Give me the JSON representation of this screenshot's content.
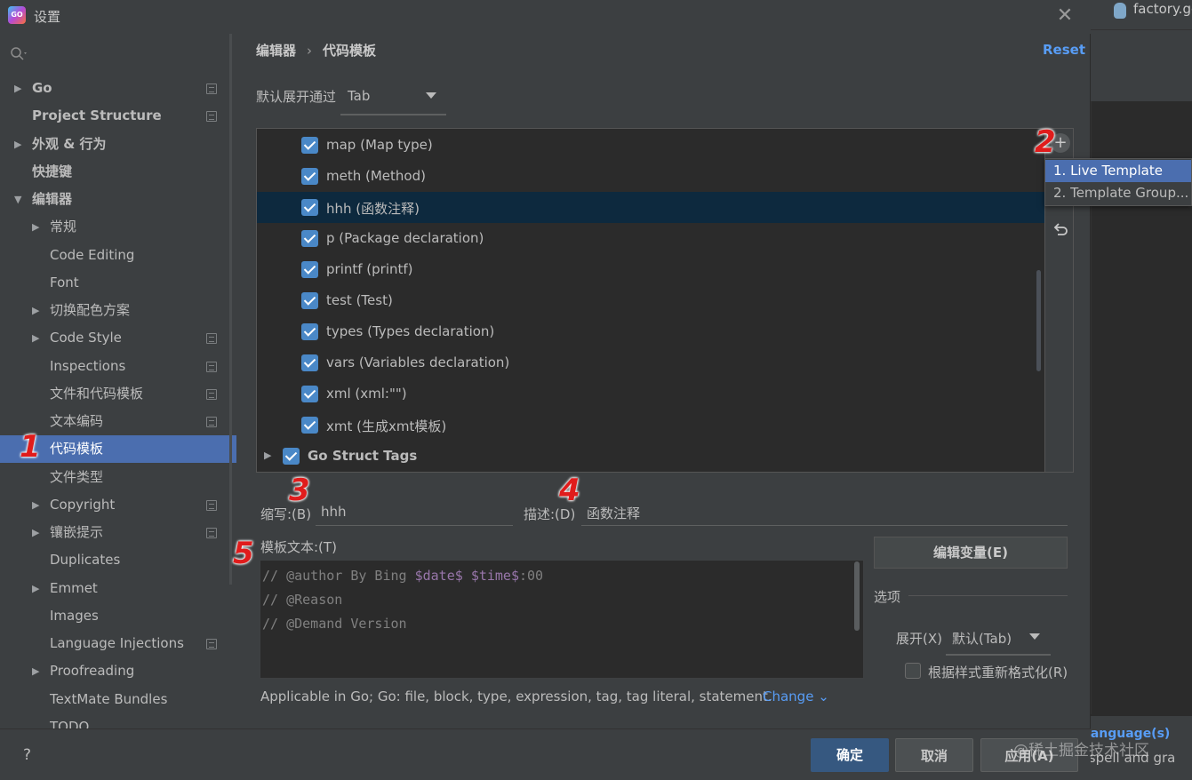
{
  "window": {
    "title": "设置",
    "app_icon": "GO"
  },
  "background_ide": {
    "tab_name": "factory.go",
    "bottom_line1": "g Language(s)",
    "bottom_line2": "se spell and gra"
  },
  "sidebar": {
    "items": [
      {
        "label": "Go",
        "arrow": "▶",
        "bold": true,
        "proj": true
      },
      {
        "label": "Project Structure",
        "arrow": "",
        "bold": true,
        "proj": true
      },
      {
        "label": "外观 & 行为",
        "arrow": "▶",
        "bold": true,
        "proj": false
      },
      {
        "label": "快捷键",
        "arrow": "",
        "bold": true,
        "proj": false
      },
      {
        "label": "编辑器",
        "arrow": "▼",
        "bold": true,
        "proj": false
      },
      {
        "label": "常规",
        "arrow": "▶",
        "bold": false,
        "proj": false
      },
      {
        "label": "Code Editing",
        "arrow": "",
        "bold": false,
        "proj": false
      },
      {
        "label": "Font",
        "arrow": "",
        "bold": false,
        "proj": false
      },
      {
        "label": "切换配色方案",
        "arrow": "▶",
        "bold": false,
        "proj": false
      },
      {
        "label": "Code Style",
        "arrow": "▶",
        "bold": false,
        "proj": true
      },
      {
        "label": "Inspections",
        "arrow": "",
        "bold": false,
        "proj": true
      },
      {
        "label": "文件和代码模板",
        "arrow": "",
        "bold": false,
        "proj": true
      },
      {
        "label": "文本编码",
        "arrow": "",
        "bold": false,
        "proj": true
      },
      {
        "label": "代码模板",
        "arrow": "",
        "bold": false,
        "proj": false,
        "selected": true
      },
      {
        "label": "文件类型",
        "arrow": "",
        "bold": false,
        "proj": false
      },
      {
        "label": "Copyright",
        "arrow": "▶",
        "bold": false,
        "proj": true
      },
      {
        "label": "镶嵌提示",
        "arrow": "▶",
        "bold": false,
        "proj": true
      },
      {
        "label": "Duplicates",
        "arrow": "",
        "bold": false,
        "proj": false
      },
      {
        "label": "Emmet",
        "arrow": "▶",
        "bold": false,
        "proj": false
      },
      {
        "label": "Images",
        "arrow": "",
        "bold": false,
        "proj": false
      },
      {
        "label": "Language Injections",
        "arrow": "",
        "bold": false,
        "proj": true
      },
      {
        "label": "Proofreading",
        "arrow": "▶",
        "bold": false,
        "proj": false
      },
      {
        "label": "TextMate Bundles",
        "arrow": "",
        "bold": false,
        "proj": false
      },
      {
        "label": "TODO",
        "arrow": "",
        "bold": false,
        "proj": false
      }
    ]
  },
  "breadcrumb": {
    "parent": "编辑器",
    "separator": "›",
    "current": "代码模板"
  },
  "reset_label": "Reset",
  "expand_with": {
    "label": "默认展开通过",
    "value": "Tab"
  },
  "templates": [
    {
      "text": "map (Map type)",
      "checked": true
    },
    {
      "text": "meth (Method)",
      "checked": true
    },
    {
      "text": "hhh (函数注释)",
      "checked": true,
      "selected": true
    },
    {
      "text": "p (Package declaration)",
      "checked": true
    },
    {
      "text": "printf (printf)",
      "checked": true
    },
    {
      "text": "test (Test)",
      "checked": true
    },
    {
      "text": "types (Types declaration)",
      "checked": true
    },
    {
      "text": "vars (Variables declaration)",
      "checked": true
    },
    {
      "text": "xml (xml:\"\")",
      "checked": true
    },
    {
      "text": "xmt (生成xmt模板)",
      "checked": true
    },
    {
      "text": "Go Struct Tags",
      "checked": true,
      "group": true
    }
  ],
  "toolbar_icons": {
    "add": "plus-icon",
    "remove": "minus-icon",
    "restore": "undo-icon"
  },
  "add_popup": {
    "items": [
      "1. Live Template",
      "2. Template Group..."
    ],
    "active_index": 0
  },
  "callouts": [
    "1",
    "2",
    "3",
    "4",
    "5"
  ],
  "detail": {
    "abbreviation_label": "缩写:(B)",
    "abbreviation_value": "hhh",
    "description_label": "描述:(D)",
    "description_value": "函数注释",
    "template_text_label": "模板文本:(T)",
    "code_lines": [
      {
        "before": "// @author By Bing ",
        "var1": "$date$",
        "mid": " ",
        "var2": "$time$",
        "after": ":00"
      },
      {
        "before": "// @Reason",
        "var1": "",
        "mid": "",
        "var2": "",
        "after": ""
      },
      {
        "before": "// @Demand Version",
        "var1": "",
        "mid": "",
        "var2": "",
        "after": ""
      }
    ],
    "edit_variables_label": "编辑变量(E)",
    "options_label": "选项",
    "expand_label": "展开(X)",
    "expand_value": "默认(Tab)",
    "reformat_label": "根据样式重新格式化(R)",
    "reformat_checked": false,
    "applicable_text": "Applicable in Go; Go: file, block, type, expression, tag, tag literal, statement.",
    "change_label": "Change ⌄"
  },
  "footer": {
    "help": "?",
    "ok": "确定",
    "cancel": "取消",
    "apply": "应用(A)"
  },
  "watermark": "@稀土掘金技术社区",
  "colors": {
    "accent": "#4b6eaf",
    "link": "#589df6",
    "callout": "#e01c1c",
    "checkbox": "#4a88c7"
  }
}
